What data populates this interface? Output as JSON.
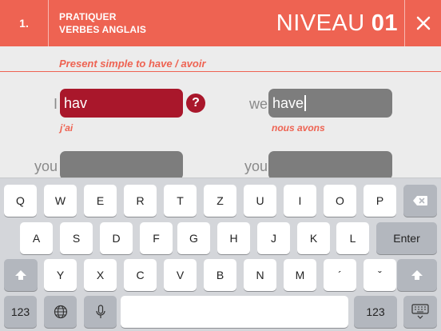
{
  "header": {
    "lesson_number": "1.",
    "title_line1": "PRATIQUER",
    "title_line2": "VERBES ANGLAIS",
    "level_label": "NIVEAU",
    "level_number": "01",
    "close_icon": "close-icon"
  },
  "exercise": {
    "subtitle": "Present simple to have / avoir",
    "rows": [
      {
        "left": {
          "pronoun": "I",
          "value": "hav",
          "translation": "j'ai"
        },
        "right": {
          "pronoun": "we",
          "value": "have",
          "translation": "nous avons"
        }
      },
      {
        "left": {
          "pronoun": "you",
          "value": ""
        },
        "right": {
          "pronoun": "you",
          "value": ""
        }
      }
    ],
    "help_label": "?"
  },
  "keyboard": {
    "row1": [
      "Q",
      "W",
      "E",
      "R",
      "T",
      "Z",
      "U",
      "I",
      "O",
      "P"
    ],
    "row2": [
      "A",
      "S",
      "D",
      "F",
      "G",
      "H",
      "J",
      "K",
      "L"
    ],
    "enter_label": "Enter",
    "row3": [
      "Y",
      "X",
      "C",
      "V",
      "B",
      "N",
      "M",
      "´",
      "ˇ"
    ],
    "numbers_label_left": "123",
    "numbers_label_right": "123",
    "icons": [
      "backspace-icon",
      "shift-icon",
      "globe-icon",
      "microphone-icon",
      "keyboard-dismiss-icon"
    ]
  },
  "colors": {
    "accent": "#ee6352",
    "answer_field": "#a9172b",
    "empty_field": "#7d7d7d"
  }
}
